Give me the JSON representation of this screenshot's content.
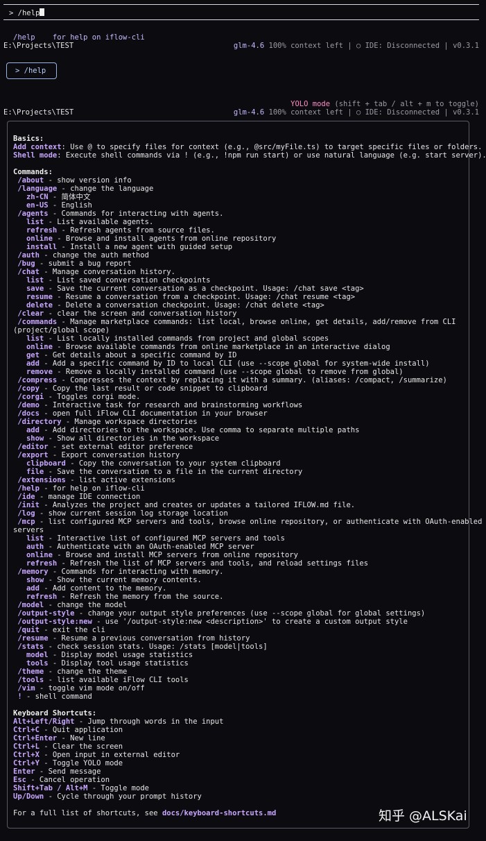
{
  "input": {
    "prompt": ">",
    "value": "/help"
  },
  "suggestion": {
    "cmd": "/help",
    "desc": "for help on iflow-cli"
  },
  "status": {
    "path": "E:\\Projects\\TEST",
    "model": "glm-4.6",
    "context": "100% context left",
    "sep1": "|",
    "ide_icon": "○",
    "ide": "IDE: Disconnected",
    "sep2": "|",
    "version": "v0.3.1"
  },
  "bubble": {
    "text": "> /help"
  },
  "yolo": {
    "label": "YOLO mode",
    "hint": "(shift + tab / alt + m to toggle)"
  },
  "help": {
    "basics_title": "Basics:",
    "basics": [
      {
        "k": "Add context",
        "d": ": Use @ to specify files for context (e.g., @src/myFile.ts) to target specific files or folders."
      },
      {
        "k": "Shell mode",
        "d": ": Execute shell commands via ! (e.g., !npm run start) or use natural language (e.g. start server)."
      }
    ],
    "commands_title": "Commands:",
    "commands": [
      {
        "i": 1,
        "k": "/about",
        "d": " - show version info"
      },
      {
        "i": 1,
        "k": "/language",
        "d": " - change the language"
      },
      {
        "i": 3,
        "k": "zh-CN",
        "d": " - 简体中文"
      },
      {
        "i": 3,
        "k": "en-US",
        "d": " - English"
      },
      {
        "i": 1,
        "k": "/agents",
        "d": " - Commands for interacting with agents."
      },
      {
        "i": 3,
        "k": "list",
        "d": " - List available agents."
      },
      {
        "i": 3,
        "k": "refresh",
        "d": " - Refresh agents from source files."
      },
      {
        "i": 3,
        "k": "online",
        "d": " - Browse and install agents from online repository"
      },
      {
        "i": 3,
        "k": "install",
        "d": " - Install a new agent with guided setup"
      },
      {
        "i": 1,
        "k": "/auth",
        "d": " - change the auth method"
      },
      {
        "i": 1,
        "k": "/bug",
        "d": " - submit a bug report"
      },
      {
        "i": 1,
        "k": "/chat",
        "d": " - Manage conversation history."
      },
      {
        "i": 3,
        "k": "list",
        "d": " - List saved conversation checkpoints"
      },
      {
        "i": 3,
        "k": "save",
        "d": " - Save the current conversation as a checkpoint. Usage: /chat save <tag>"
      },
      {
        "i": 3,
        "k": "resume",
        "d": " - Resume a conversation from a checkpoint. Usage: /chat resume <tag>"
      },
      {
        "i": 3,
        "k": "delete",
        "d": " - Delete a conversation checkpoint. Usage: /chat delete <tag>"
      },
      {
        "i": 1,
        "k": "/clear",
        "d": " - clear the screen and conversation history"
      },
      {
        "i": 1,
        "k": "/commands",
        "d": " - Manage marketplace commands: list local, browse online, get details, add/remove from CLI"
      },
      {
        "i": 0,
        "k": "",
        "d": "(project/global scope)"
      },
      {
        "i": 3,
        "k": "list",
        "d": " - List locally installed commands from project and global scopes"
      },
      {
        "i": 3,
        "k": "online",
        "d": " - Browse available commands from online marketplace in an interactive dialog"
      },
      {
        "i": 3,
        "k": "get",
        "d": " - Get details about a specific command by ID"
      },
      {
        "i": 3,
        "k": "add",
        "d": " - Add a specific command by ID to local CLI (use --scope global for system-wide install)"
      },
      {
        "i": 3,
        "k": "remove",
        "d": " - Remove a locally installed command (use --scope global to remove from global)"
      },
      {
        "i": 1,
        "k": "/compress",
        "d": " - Compresses the context by replacing it with a summary. (aliases: /compact, /summarize)"
      },
      {
        "i": 1,
        "k": "/copy",
        "d": " - Copy the last result or code snippet to clipboard"
      },
      {
        "i": 1,
        "k": "/corgi",
        "d": " - Toggles corgi mode."
      },
      {
        "i": 1,
        "k": "/demo",
        "d": " - Interactive task for research and brainstorming workflows"
      },
      {
        "i": 1,
        "k": "/docs",
        "d": " - open full iFlow CLI documentation in your browser"
      },
      {
        "i": 1,
        "k": "/directory",
        "d": " - Manage workspace directories"
      },
      {
        "i": 3,
        "k": "add",
        "d": " - Add directories to the workspace. Use comma to separate multiple paths"
      },
      {
        "i": 3,
        "k": "show",
        "d": " - Show all directories in the workspace"
      },
      {
        "i": 1,
        "k": "/editor",
        "d": " - set external editor preference"
      },
      {
        "i": 1,
        "k": "/export",
        "d": " - Export conversation history"
      },
      {
        "i": 3,
        "k": "clipboard",
        "d": " - Copy the conversation to your system clipboard"
      },
      {
        "i": 3,
        "k": "file",
        "d": " - Save the conversation to a file in the current directory"
      },
      {
        "i": 1,
        "k": "/extensions",
        "d": " - list active extensions"
      },
      {
        "i": 1,
        "k": "/help",
        "d": " - for help on iflow-cli"
      },
      {
        "i": 1,
        "k": "/ide",
        "d": " - manage IDE connection"
      },
      {
        "i": 1,
        "k": "/init",
        "d": " - Analyzes the project and creates or updates a tailored IFLOW.md file."
      },
      {
        "i": 1,
        "k": "/log",
        "d": " - show current session log storage location"
      },
      {
        "i": 1,
        "k": "/mcp",
        "d": " - list configured MCP servers and tools, browse online repository, or authenticate with OAuth-enabled"
      },
      {
        "i": 0,
        "k": "",
        "d": "servers"
      },
      {
        "i": 3,
        "k": "list",
        "d": " - Interactive list of configured MCP servers and tools"
      },
      {
        "i": 3,
        "k": "auth",
        "d": " - Authenticate with an OAuth-enabled MCP server"
      },
      {
        "i": 3,
        "k": "online",
        "d": " - Browse and install MCP servers from online repository"
      },
      {
        "i": 3,
        "k": "refresh",
        "d": " - Refresh the list of MCP servers and tools, and reload settings files"
      },
      {
        "i": 1,
        "k": "/memory",
        "d": " - Commands for interacting with memory."
      },
      {
        "i": 3,
        "k": "show",
        "d": " - Show the current memory contents."
      },
      {
        "i": 3,
        "k": "add",
        "d": " - Add content to the memory."
      },
      {
        "i": 3,
        "k": "refresh",
        "d": " - Refresh the memory from the source."
      },
      {
        "i": 1,
        "k": "/model",
        "d": " - change the model"
      },
      {
        "i": 1,
        "k": "/output-style",
        "d": " - change your output style preferences (use --scope global for global settings)"
      },
      {
        "i": 1,
        "k": "/output-style:new",
        "d": " - use '/output-style:new <description>' to create a custom output style"
      },
      {
        "i": 1,
        "k": "/quit",
        "d": " - exit the cli"
      },
      {
        "i": 1,
        "k": "/resume",
        "d": " - Resume a previous conversation from history"
      },
      {
        "i": 1,
        "k": "/stats",
        "d": " - check session stats. Usage: /stats [model|tools]"
      },
      {
        "i": 3,
        "k": "model",
        "d": " - Display model usage statistics"
      },
      {
        "i": 3,
        "k": "tools",
        "d": " - Display tool usage statistics"
      },
      {
        "i": 1,
        "k": "/theme",
        "d": " - change the theme"
      },
      {
        "i": 1,
        "k": "/tools",
        "d": " - list available iFlow CLI tools"
      },
      {
        "i": 1,
        "k": "/vim",
        "d": " - toggle vim mode on/off"
      },
      {
        "i": 1,
        "k": "!",
        "d": " - shell command"
      }
    ],
    "shortcuts_title": "Keyboard Shortcuts:",
    "shortcuts": [
      {
        "k": "Alt+Left/Right",
        "d": " - Jump through words in the input"
      },
      {
        "k": "Ctrl+C",
        "d": " - Quit application"
      },
      {
        "k": "Ctrl+Enter",
        "d": " - New line"
      },
      {
        "k": "Ctrl+L",
        "d": " - Clear the screen"
      },
      {
        "k": "Ctrl+X",
        "d": " - Open input in external editor"
      },
      {
        "k": "Ctrl+Y",
        "d": " - Toggle YOLO mode"
      },
      {
        "k": "Enter",
        "d": " - Send message"
      },
      {
        "k": "Esc",
        "d": " - Cancel operation"
      },
      {
        "k": "Shift+Tab / Alt+M",
        "d": " - Toggle mode"
      },
      {
        "k": "Up/Down",
        "d": " - Cycle through your prompt history"
      }
    ],
    "footer_text": "For a full list of shortcuts, see ",
    "footer_link": "docs/keyboard-shortcuts.md"
  },
  "watermark": "知乎 @ALSKai",
  "colors": {
    "accent": "#c8a6ff",
    "model": "#c7b8ff",
    "yolo": "#ff8cc6",
    "dim": "#9a9aa6"
  }
}
